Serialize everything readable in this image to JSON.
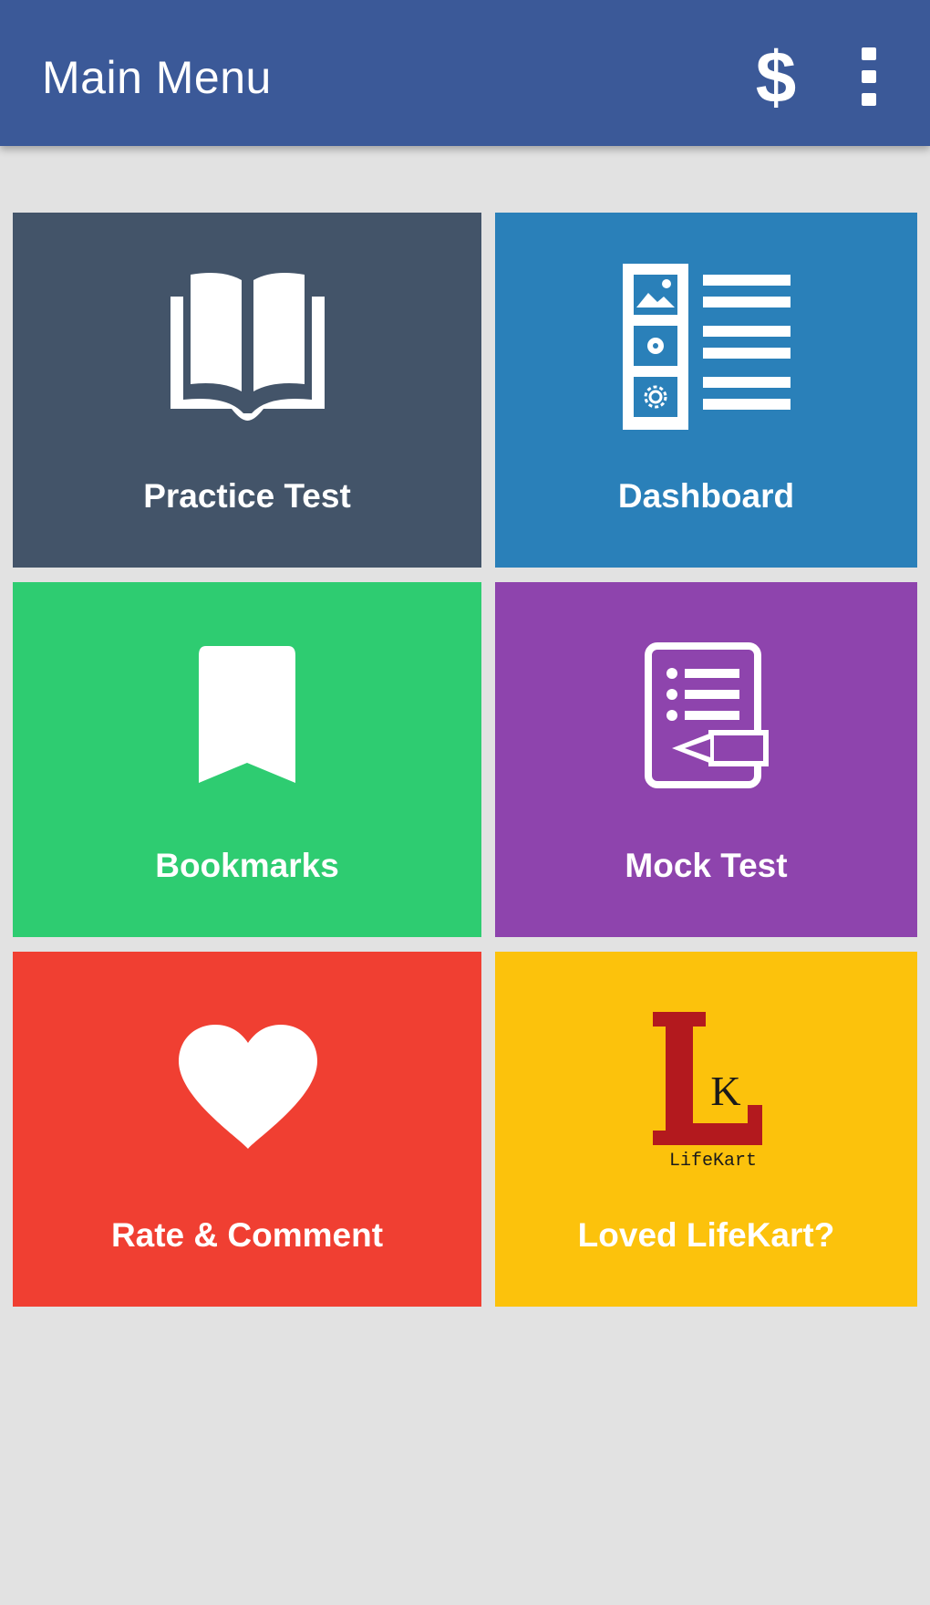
{
  "appbar": {
    "title": "Main Menu",
    "actions": [
      {
        "icon": "dollar-icon"
      },
      {
        "icon": "more-vert-icon"
      }
    ]
  },
  "tiles": [
    {
      "label": "Practice Test",
      "icon": "open-book-icon",
      "color": "#435469"
    },
    {
      "label": "Dashboard",
      "icon": "dashboard-icon",
      "color": "#2a80b9"
    },
    {
      "label": "Bookmarks",
      "icon": "bookmark-icon",
      "color": "#2ecc71"
    },
    {
      "label": "Mock Test",
      "icon": "test-paper-pencil-icon",
      "color": "#8e44ad"
    },
    {
      "label": "Rate & Comment",
      "icon": "heart-icon",
      "color": "#f03f32"
    },
    {
      "label": "Loved LifeKart?",
      "icon": "lifekart-logo",
      "color": "#fcc20c"
    }
  ],
  "logo": {
    "text": "LifeKart"
  },
  "colors": {
    "appbar": "#3b5998",
    "background": "#e2e2e2",
    "logo_red": "#b3191e"
  }
}
